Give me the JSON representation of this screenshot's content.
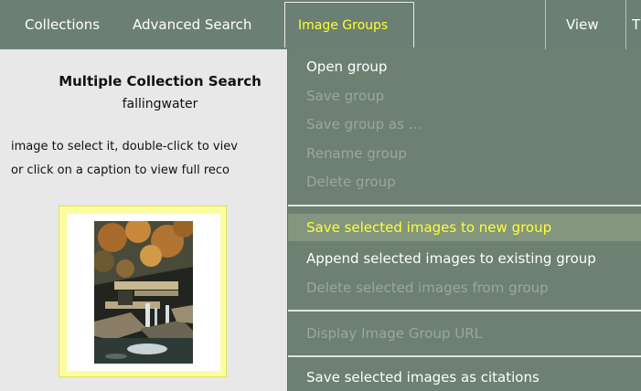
{
  "menubar": {
    "collections": "Collections",
    "advanced_search": "Advanced Search",
    "image_groups": "Image Groups",
    "view": "View",
    "truncated": "T"
  },
  "left_panel": {
    "title": "Multiple Collection Search",
    "subtitle": "fallingwater",
    "instruction_line1": "image to select it, double-click to viev",
    "instruction_line2": "or click on a caption to view full reco"
  },
  "dropdown": {
    "open_group": "Open group",
    "save_group": "Save group",
    "save_group_as": "Save group as ...",
    "rename_group": "Rename group",
    "delete_group": "Delete group",
    "save_selected_new": "Save selected images to new group",
    "append_selected": "Append selected images to existing group",
    "delete_selected": "Delete selected images from group",
    "display_url": "Display Image Group URL",
    "save_citations": "Save selected images as citations"
  },
  "colors": {
    "menubar_bg": "#6c7f74",
    "menu_text": "#ffffff",
    "menu_active_text": "#ffff33",
    "dropdown_bg": "#6d8072",
    "disabled_text": "#9aa79e",
    "highlight_bg": "#84967f",
    "thumbnail_frame": "#fcfca0"
  }
}
